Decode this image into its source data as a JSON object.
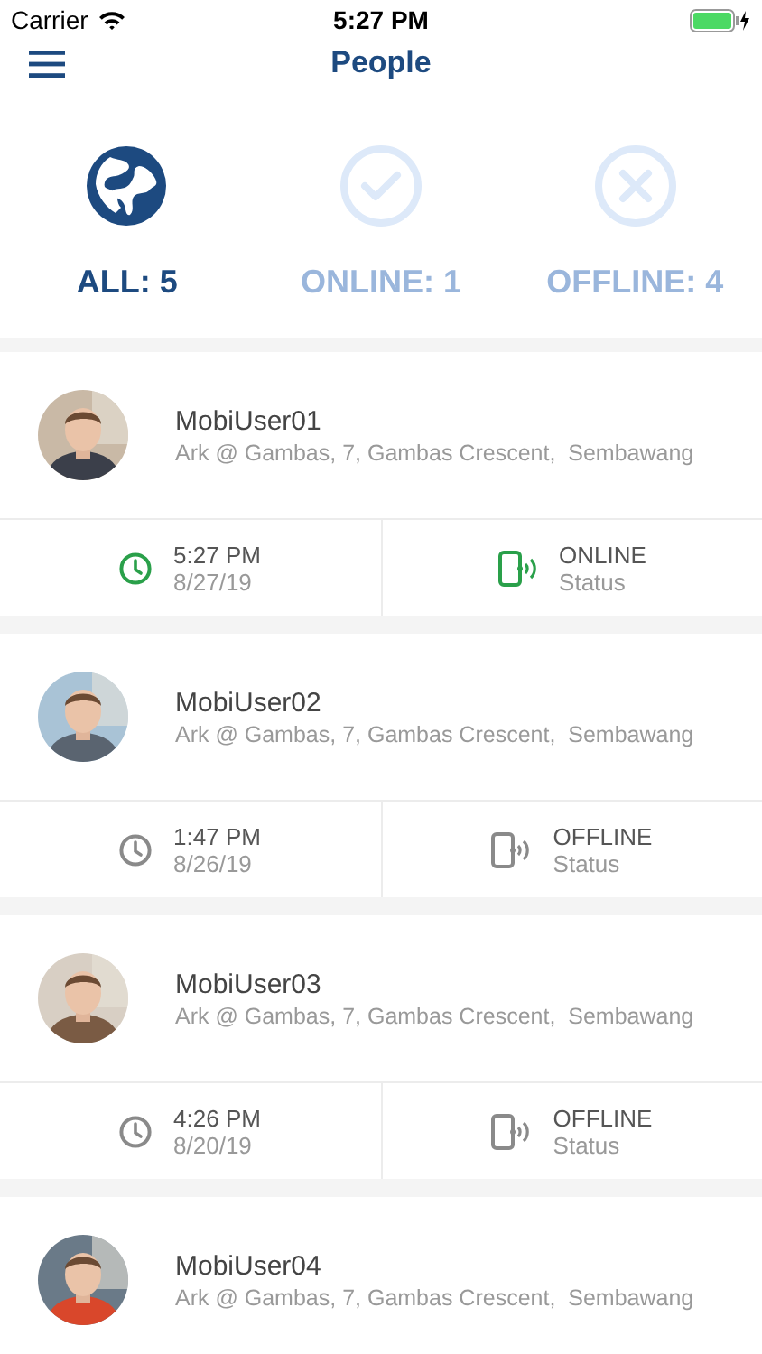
{
  "status_bar": {
    "carrier": "Carrier",
    "time": "5:27 PM"
  },
  "nav": {
    "title": "People"
  },
  "filters": [
    {
      "kind": "all",
      "label": "ALL: 5",
      "selected": true
    },
    {
      "kind": "online",
      "label": "ONLINE: 1",
      "selected": false
    },
    {
      "kind": "offline",
      "label": "OFFLINE: 4",
      "selected": false
    }
  ],
  "people": [
    {
      "name": "MobiUser01",
      "address": "Ark @ Gambas, 7, Gambas Crescent,  Sembawang",
      "time": "5:27 PM",
      "date": "8/27/19",
      "status": "ONLINE",
      "status_label": "Status",
      "online": true
    },
    {
      "name": "MobiUser02",
      "address": "Ark @ Gambas, 7, Gambas Crescent,  Sembawang",
      "time": "1:47 PM",
      "date": "8/26/19",
      "status": "OFFLINE",
      "status_label": "Status",
      "online": false
    },
    {
      "name": "MobiUser03",
      "address": "Ark @ Gambas, 7, Gambas Crescent,  Sembawang",
      "time": "4:26 PM",
      "date": "8/20/19",
      "status": "OFFLINE",
      "status_label": "Status",
      "online": false
    },
    {
      "name": "MobiUser04",
      "address": "Ark @ Gambas, 7, Gambas Crescent,  Sembawang"
    }
  ]
}
